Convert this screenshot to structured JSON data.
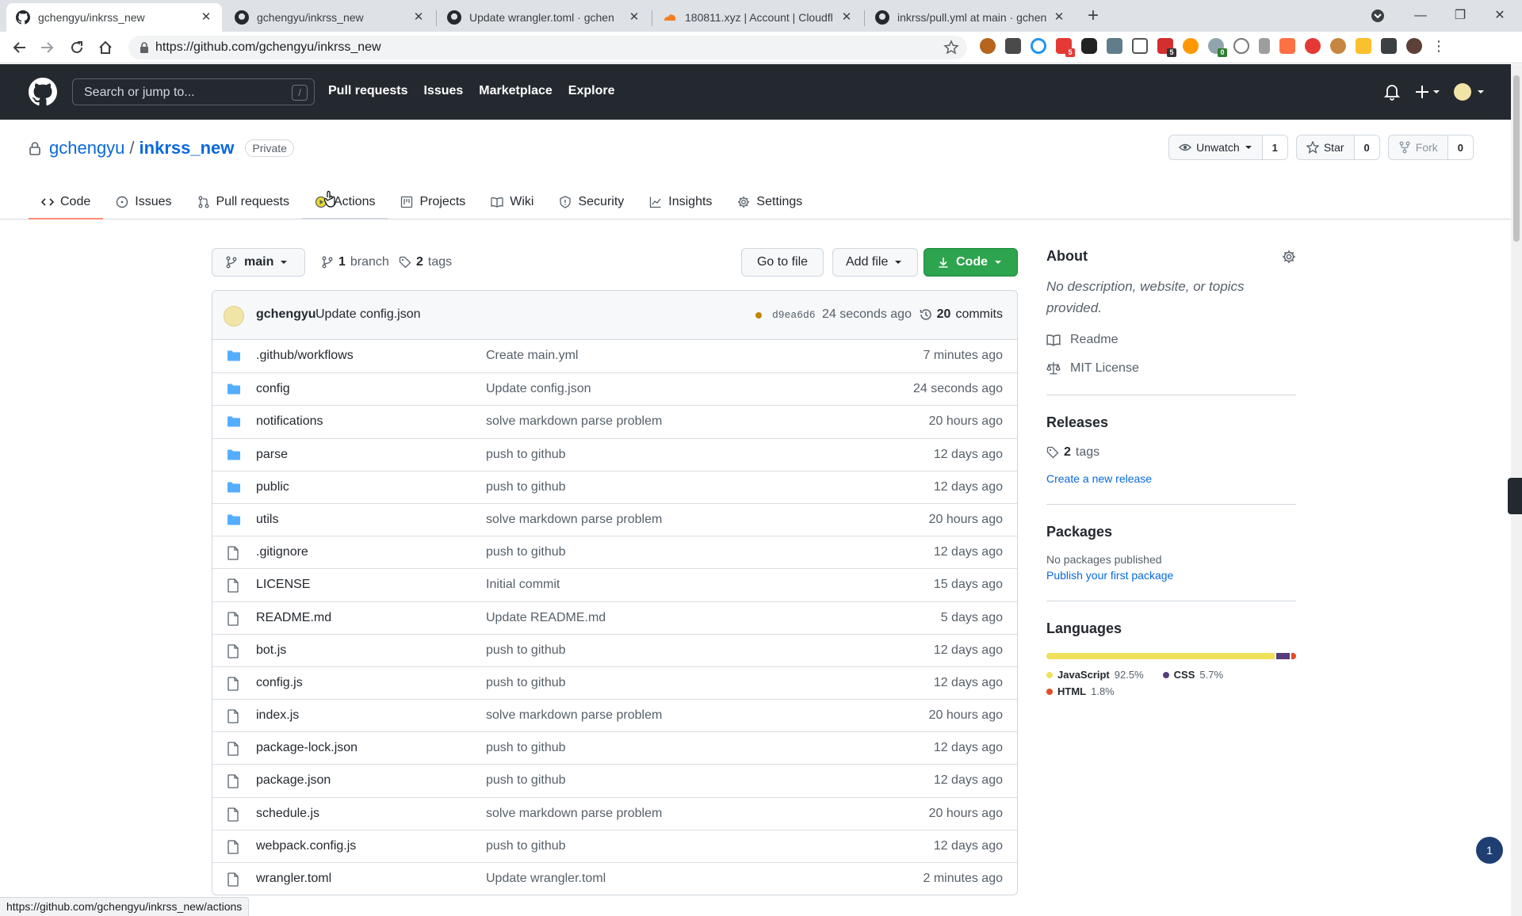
{
  "browser": {
    "tabs": [
      {
        "title": "gchengyu/inkrss_new",
        "active": true,
        "favicon": "github-icon"
      },
      {
        "title": "gchengyu/inkrss_new",
        "active": false,
        "favicon": "github-icon"
      },
      {
        "title": "Update wrangler.toml · gchen",
        "active": false,
        "favicon": "github-icon"
      },
      {
        "title": "180811.xyz | Account | Cloudfl",
        "active": false,
        "favicon": "cloudflare-icon"
      },
      {
        "title": "inkrss/pull.yml at main · gchen",
        "active": false,
        "favicon": "github-icon"
      }
    ],
    "url": "https://github.com/gchengyu/inkrss_new",
    "status_url": "https://github.com/gchengyu/inkrss_new/actions"
  },
  "gh_header": {
    "search_placeholder": "Search or jump to...",
    "search_shortcut": "/",
    "nav": [
      "Pull requests",
      "Issues",
      "Marketplace",
      "Explore"
    ]
  },
  "repo": {
    "owner": "gchengyu",
    "separator": "/",
    "name": "inkrss_new",
    "visibility": "Private",
    "watch_label": "Unwatch",
    "watch_count": "1",
    "star_label": "Star",
    "star_count": "0",
    "fork_label": "Fork",
    "fork_count": "0",
    "tabs": [
      {
        "label": "Code",
        "icon": "code-icon"
      },
      {
        "label": "Issues",
        "icon": "issue-icon"
      },
      {
        "label": "Pull requests",
        "icon": "pull-request-icon"
      },
      {
        "label": "Actions",
        "icon": "play-icon"
      },
      {
        "label": "Projects",
        "icon": "project-icon"
      },
      {
        "label": "Wiki",
        "icon": "book-icon"
      },
      {
        "label": "Security",
        "icon": "shield-icon"
      },
      {
        "label": "Insights",
        "icon": "graph-icon"
      },
      {
        "label": "Settings",
        "icon": "gear-icon"
      }
    ]
  },
  "branch_bar": {
    "branch": "main",
    "branch_count": "1",
    "branch_word": "branch",
    "tag_count": "2",
    "tag_word": "tags",
    "goto_file": "Go to file",
    "add_file": "Add file",
    "code": "Code"
  },
  "latest_commit": {
    "author": "gchengyu",
    "message": "Update config.json",
    "sha": "d9ea6d6",
    "when": "24 seconds ago",
    "count": "20",
    "count_word": "commits"
  },
  "files": [
    {
      "name": ".github/workflows",
      "type": "dir",
      "message": "Create main.yml",
      "age": "7 minutes ago"
    },
    {
      "name": "config",
      "type": "dir",
      "message": "Update config.json",
      "age": "24 seconds ago"
    },
    {
      "name": "notifications",
      "type": "dir",
      "message": "solve markdown parse problem",
      "age": "20 hours ago"
    },
    {
      "name": "parse",
      "type": "dir",
      "message": "push to github",
      "age": "12 days ago"
    },
    {
      "name": "public",
      "type": "dir",
      "message": "push to github",
      "age": "12 days ago"
    },
    {
      "name": "utils",
      "type": "dir",
      "message": "solve markdown parse problem",
      "age": "20 hours ago"
    },
    {
      "name": ".gitignore",
      "type": "file",
      "message": "push to github",
      "age": "12 days ago"
    },
    {
      "name": "LICENSE",
      "type": "file",
      "message": "Initial commit",
      "age": "15 days ago"
    },
    {
      "name": "README.md",
      "type": "file",
      "message": "Update README.md",
      "age": "5 days ago"
    },
    {
      "name": "bot.js",
      "type": "file",
      "message": "push to github",
      "age": "12 days ago"
    },
    {
      "name": "config.js",
      "type": "file",
      "message": "push to github",
      "age": "12 days ago"
    },
    {
      "name": "index.js",
      "type": "file",
      "message": "solve markdown parse problem",
      "age": "20 hours ago"
    },
    {
      "name": "package-lock.json",
      "type": "file",
      "message": "push to github",
      "age": "12 days ago"
    },
    {
      "name": "package.json",
      "type": "file",
      "message": "push to github",
      "age": "12 days ago"
    },
    {
      "name": "schedule.js",
      "type": "file",
      "message": "solve markdown parse problem",
      "age": "20 hours ago"
    },
    {
      "name": "webpack.config.js",
      "type": "file",
      "message": "push to github",
      "age": "12 days ago"
    },
    {
      "name": "wrangler.toml",
      "type": "file",
      "message": "Update wrangler.toml",
      "age": "2 minutes ago"
    }
  ],
  "about": {
    "title": "About",
    "description": "No description, website, or topics provided.",
    "readme": "Readme",
    "license": "MIT License"
  },
  "releases": {
    "title": "Releases",
    "tag_count": "2",
    "tag_word": "tags",
    "create_link": "Create a new release"
  },
  "packages": {
    "title": "Packages",
    "none": "No packages published",
    "publish_link": "Publish your first package"
  },
  "languages": {
    "title": "Languages",
    "items": [
      {
        "name": "JavaScript",
        "percent": "92.5%",
        "value": 92.5,
        "color": "#f1e05a"
      },
      {
        "name": "CSS",
        "percent": "5.7%",
        "value": 5.7,
        "color": "#563d7c"
      },
      {
        "name": "HTML",
        "percent": "1.8%",
        "value": 1.8,
        "color": "#e34c26"
      }
    ]
  },
  "notification_count": "1"
}
